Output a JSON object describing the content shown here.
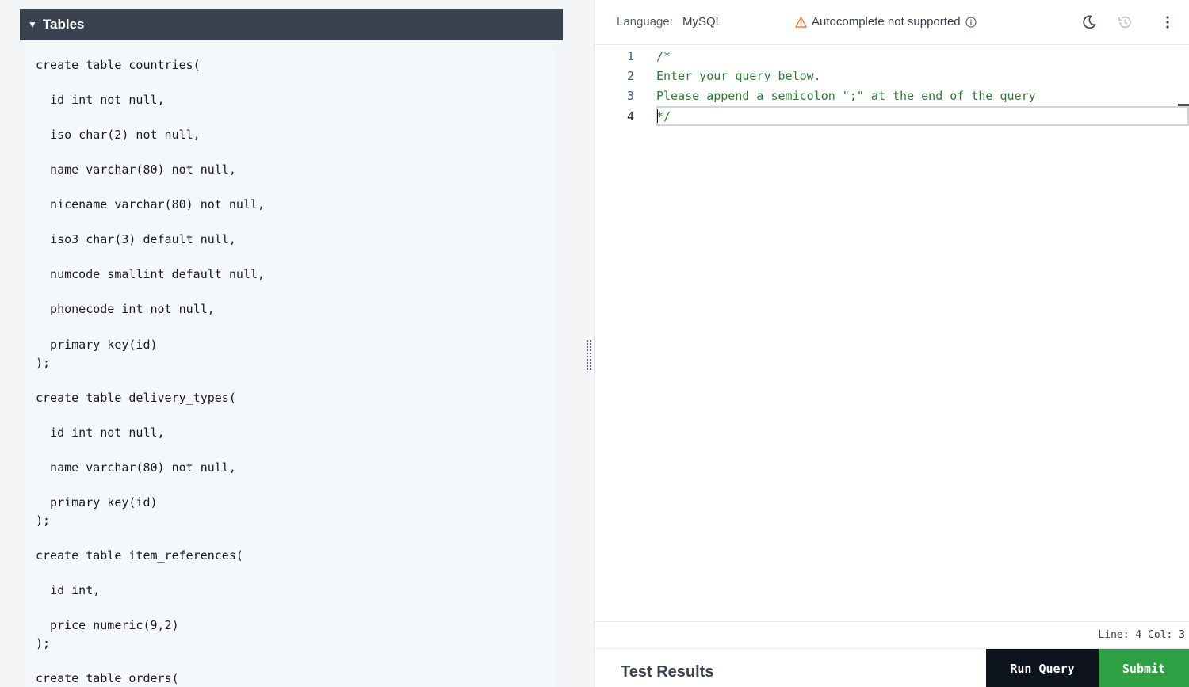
{
  "left_panel": {
    "section_title": "Tables",
    "schema_lines": [
      "create table countries(",
      "  id int not null,",
      "  iso char(2) not null,",
      "  name varchar(80) not null,",
      "  nicename varchar(80) not null,",
      "  iso3 char(3) default null,",
      "  numcode smallint default null,",
      "  phonecode int not null,",
      "  primary key(id)",
      ");",
      "create table delivery_types(",
      "  id int not null,",
      "  name varchar(80) not null,",
      "  primary key(id)",
      ");",
      "create table item_references(",
      "  id int,",
      "  price numeric(9,2)",
      ");",
      "create table orders("
    ]
  },
  "toolbar": {
    "language_label": "Language:",
    "language_value": "MySQL",
    "autocomplete_text": "Autocomplete not supported",
    "icons": [
      "warning-icon",
      "info-icon",
      "moon-icon",
      "history-icon",
      "kebab-menu-icon"
    ]
  },
  "editor": {
    "line_numbers": [
      "1",
      "2",
      "3",
      "4"
    ],
    "lines": [
      "/*",
      "Enter your query below.",
      "Please append a semicolon \";\" at the end of the query",
      "*/"
    ],
    "active_line": 4
  },
  "status": {
    "position": "Line: 4 Col: 3"
  },
  "bottom": {
    "test_results": "Test Results",
    "run_query": "Run Query",
    "submit": "Submit"
  },
  "colors": {
    "header_bg": "#39424e",
    "comment": "#2e7d32",
    "run_bg": "#0e141e",
    "submit_bg": "#2ea043"
  }
}
